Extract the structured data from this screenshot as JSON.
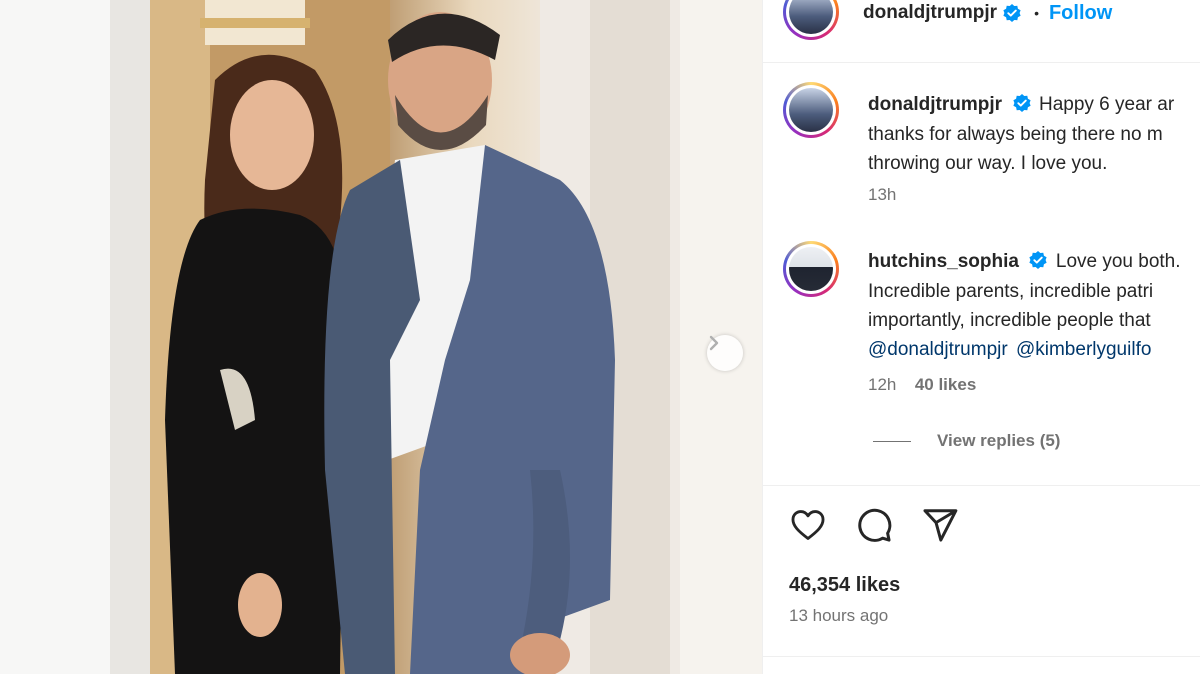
{
  "header": {
    "username": "donaldjtrumpjr",
    "separator": "•",
    "follow_label": "Follow"
  },
  "comments": [
    {
      "username": "donaldjtrumpjr",
      "lines": [
        "Happy 6 year ar",
        "thanks for always being there no m",
        "throwing our way. I love you."
      ],
      "time": "13h"
    },
    {
      "username": "hutchins_sophia",
      "lines": [
        "Love you both.",
        "Incredible parents, incredible patri",
        "importantly, incredible people that"
      ],
      "mentions": [
        "@donaldjtrumpjr",
        "@kimberlyguilfo"
      ],
      "time": "12h",
      "likes": "40 likes",
      "view_replies": "View replies (5)"
    }
  ],
  "actions": {
    "like_icon": "heart-icon",
    "comment_icon": "comment-icon",
    "share_icon": "paper-plane-icon"
  },
  "post": {
    "likes": "46,354 likes",
    "time_ago": "13 hours ago"
  },
  "colors": {
    "verified_blue": "#0095f6",
    "follow_blue": "#0095f6",
    "mention_blue": "#00376b",
    "meta_gray": "#737373"
  }
}
